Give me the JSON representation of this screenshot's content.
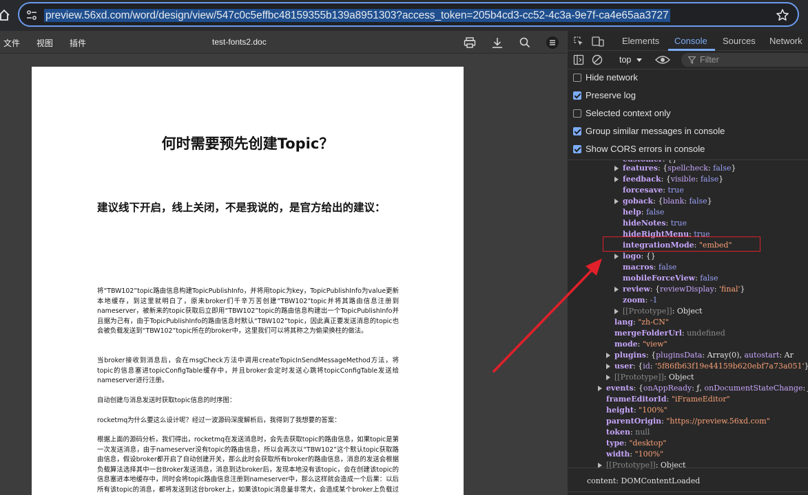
{
  "browser": {
    "url": "preview.56xd.com/word/design/view/547c0c5effbc48159355b139a8951303?access_token=205b4cd3-cc52-4c3a-9e7f-ca4e65aa3727"
  },
  "doc_app": {
    "menu": [
      "文件",
      "视图",
      "插件"
    ],
    "file_title": "test-fonts2.doc",
    "page": {
      "title": "何时需要预先创建Topic？",
      "subtitle": "建议线下开启，线上关闭，不是我说的，是官方给出的建议：",
      "paragraphs": [
        "将“TBW102”topic路由信息构建TopicPublishInfo，并将用topic为key，TopicPublishInfo为value更新本地缓存，到这里就明白了，原来broker们千辛万苦创建“TBW102”topic并将其路由信息注册到nameserver，被新来的topic获取后立即用“TBW102”topic的路由信息构建出一个TopicPublishInfo并且据为己有，由于TopicPublishInfo的路由信息时默认“TBW102”topic，因此真正要发送消息的topic也会被负载发送到“TBW102”topic所在的broker中，这里我们可以将其称之为偷梁换柱的做法。",
        "当broker接收到消息后，会在msgCheck方法中调用createTopicInSendMessageMethod方法，将topic的信息塞进topicConfigTable缓存中，并且broker会定时发送心跳将topicConfigTable发送给nameserver进行注册。",
        "自动创建与消息发送时获取topic信息的时序图：",
        "rocketmq为什么要这么设计呢？经过一波源码深度解析后，我得到了我想要的答案：",
        "根据上面的源码分析，我们得出，rocketmq在发送消息时，会先去获取topic的路由信息，如果topic是第一次发送消息，由于nameserver没有topic的路由信息，所以会再次以“TBW102”这个默认topic获取路由信息，假设broker都开启了自动创建开关，那么此时会获取所有broker的路由信息，消息的发送会根据负载算法选择其中一台Broker发送消息，消息到达broker后，发现本地没有该topic，会在创建该topic的信息塞进本地缓存中，同时会将topic路由信息注册到nameserver中，那么这样就会造成一个后果：以后所有该topic的消息，都将发送到这台broker上，如果该topic消息量非常大，会造成某个broker上负载过大，这样的消息存储就达不到负载均衡的目的了。"
      ]
    }
  },
  "devtools": {
    "tabs": [
      "Elements",
      "Console",
      "Sources",
      "Network"
    ],
    "active_tab": "Console",
    "context": "top",
    "filter_placeholder": "Filter",
    "options": [
      {
        "label": "Hide network",
        "checked": false
      },
      {
        "label": "Preserve log",
        "checked": true
      },
      {
        "label": "Selected context only",
        "checked": false
      },
      {
        "label": "Group similar messages in console",
        "checked": true
      },
      {
        "label": "Show CORS errors in console",
        "checked": true
      }
    ],
    "console_footer": "content: DOMContentLoaded",
    "accent_color": "#7cacf8",
    "highlight_color": "#e0202a"
  }
}
